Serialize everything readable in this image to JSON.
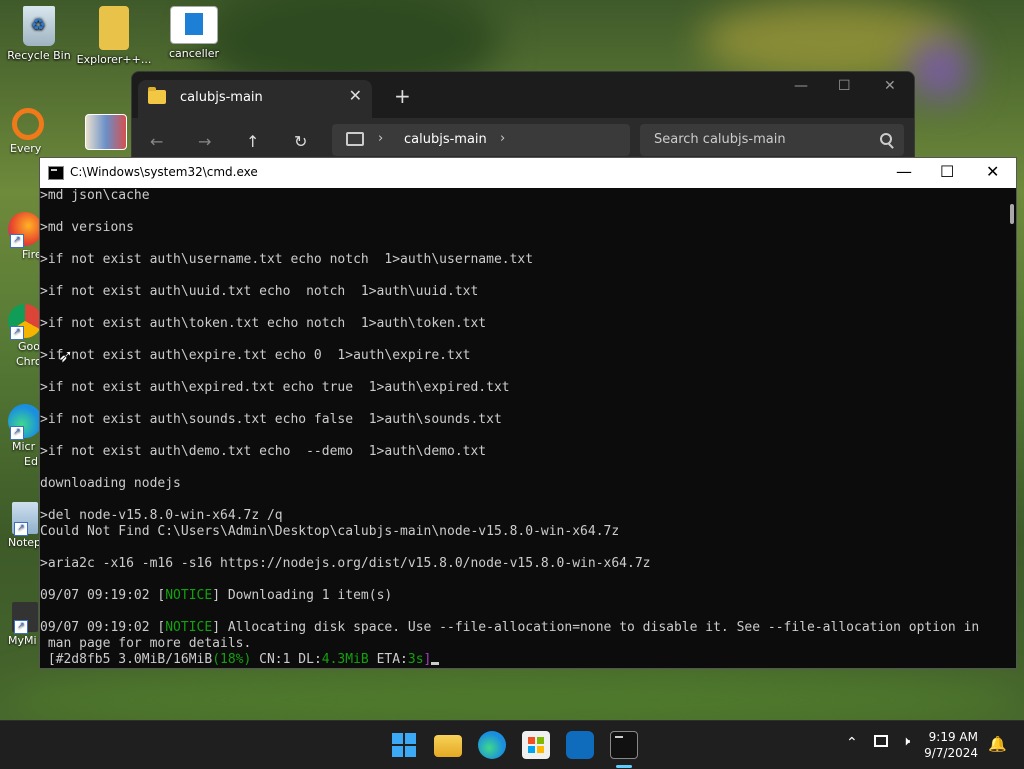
{
  "desktop": {
    "top_icons": [
      {
        "label": "Recycle Bin",
        "icon": "recycle-bin-icon"
      },
      {
        "label": "Explorer++...",
        "icon": "folder-icon"
      },
      {
        "label": "canceller",
        "icon": "document-icon"
      }
    ],
    "left_icons": [
      {
        "label": "Every",
        "icon": "everything-search-icon"
      },
      {
        "label": "Fire",
        "icon": "firefox-icon"
      },
      {
        "label": "Goo",
        "label2": "Chro",
        "icon": "chrome-icon"
      },
      {
        "label": "Micr",
        "label2": "Ed",
        "icon": "edge-icon"
      },
      {
        "label": "Notep",
        "icon": "notepad-icon"
      },
      {
        "label": "MyMi",
        "icon": "mymi-icon"
      }
    ]
  },
  "explorer": {
    "tab_title": "calubjs-main",
    "address_crumb": "calubjs-main",
    "search_placeholder": "Search calubjs-main"
  },
  "cmd": {
    "title": "C:\\Windows\\system32\\cmd.exe",
    "lines": [
      ">md json\\cache",
      "",
      ">md versions",
      "",
      ">if not exist auth\\username.txt echo notch  1>auth\\username.txt",
      "",
      ">if not exist auth\\uuid.txt echo  notch  1>auth\\uuid.txt",
      "",
      ">if not exist auth\\token.txt echo notch  1>auth\\token.txt",
      "",
      ">if not exist auth\\expire.txt echo 0  1>auth\\expire.txt",
      "",
      ">if not exist auth\\expired.txt echo true  1>auth\\expired.txt",
      "",
      ">if not exist auth\\sounds.txt echo false  1>auth\\sounds.txt",
      "",
      ">if not exist auth\\demo.txt echo  --demo  1>auth\\demo.txt",
      "",
      "downloading nodejs",
      "",
      ">del node-v15.8.0-win-x64.7z /q",
      "Could Not Find C:\\Users\\Admin\\Desktop\\calubjs-main\\node-v15.8.0-win-x64.7z",
      "",
      ">aria2c -x16 -m16 -s16 https://nodejs.org/dist/v15.8.0/node-v15.8.0-win-x64.7z",
      ""
    ],
    "notice1": {
      "ts": "09/07 09:19:02 [",
      "tag": "NOTICE",
      "msg": "] Downloading 1 item(s)"
    },
    "notice2": {
      "ts": "09/07 09:19:02 [",
      "tag": "NOTICE",
      "msg": "] Allocating disk space. Use --file-allocation=none to disable it. See --file-allocation option in",
      "cont": " man page for more details."
    },
    "progress": {
      "p1": " [#2d8fb5 3.0MiB/16MiB",
      "p2": "(18%)",
      "p3": " CN:1 DL:",
      "p4": "4.3MiB",
      "p5": " ETA:",
      "p6": "3s",
      "p7": "]"
    }
  },
  "taskbar": {
    "time": "9:19 AM",
    "date": "9/7/2024",
    "apps": [
      "windows-start-icon",
      "file-explorer-icon",
      "edge-icon",
      "microsoft-store-icon",
      "outlook-icon",
      "terminal-icon"
    ]
  }
}
